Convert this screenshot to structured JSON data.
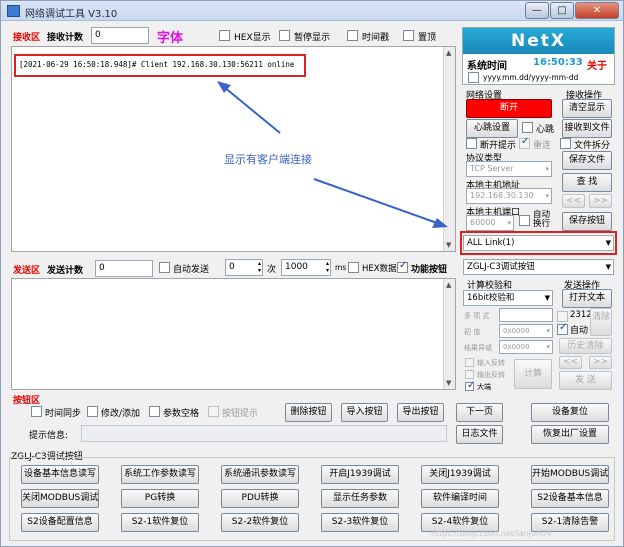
{
  "window": {
    "title": "网络调试工具  V3.10",
    "min": "—",
    "max": "□",
    "close": "✕"
  },
  "receive": {
    "area_label": "接收区",
    "count_label": "接收计数",
    "count_value": "0",
    "font_label": "字体",
    "hex_label": "HEX显示",
    "pause_label": "暂停显示",
    "timestamp_label": "时间戳",
    "top_label": "置顶",
    "log_line": "[2021-06-29 16:50:18.948]# Client 192.168.30.130:56211 online"
  },
  "annotation": {
    "text": "显示有客户端连接"
  },
  "netx": {
    "logo": "NetX",
    "time_label": "系统时间",
    "time_value": "16:50:33",
    "about_label": "关于",
    "date_format": "yyyy.mm.dd/yyyy-mm-dd"
  },
  "network": {
    "title": "网络设置",
    "disconnect": "断开",
    "heartbeat_settings": "心跳设置",
    "heartbeat": "心跳",
    "disconnect_prompt": "断开提示",
    "reconnect": "重连",
    "protocol_label": "协议类型",
    "protocol_value": "TCP Server",
    "host_label": "本地主机地址",
    "host_value": "192.168.30.130",
    "port_label": "本地主机端口",
    "port_value": "60000",
    "auto_wrap": "自动换行",
    "link_value": "ALL Link(1)"
  },
  "recv_ops": {
    "title": "接收操作",
    "clear": "清空显示",
    "to_file": "接收到文件",
    "split_file": "文件拆分",
    "save_file": "保存文件",
    "find": "查  找",
    "prev": "<<",
    "next": ">>",
    "save_buttons": "保存按钮"
  },
  "send": {
    "area_label": "发送区",
    "count_label": "发送计数",
    "count_value": "0",
    "auto_send": "自动发送",
    "times_value": "0",
    "times_unit": "次",
    "interval_value": "1000",
    "interval_unit": "ms",
    "hex_data": "HEX数据",
    "function_buttons": "功能按钮"
  },
  "calc": {
    "device_value": "ZGLJ-C3调试按钮",
    "checksum_title": "计算校验和",
    "checksum_value": "16bit校验和",
    "multi_item": "多 项 式",
    "init_value_label": "初   值",
    "init_value": "0x0000",
    "xor_label": "结果异或",
    "xor_value": "0x0000",
    "input_reverse": "输入反转",
    "output_reverse": "输出反转",
    "big_endian": "大端",
    "calc_button": "计算",
    "chk2312": "2312",
    "auto": "自动",
    "clear": "清除",
    "history_clear": "历史清除",
    "prev": "<<",
    "next": ">>",
    "send": "发  送"
  },
  "send_ops": {
    "title": "发送操作",
    "open_text": "打开文本"
  },
  "buttons_area": {
    "label": "按钮区",
    "time_sync": "时间同步",
    "modify_add": "修改/添加",
    "param_space": "参数空格",
    "button_tip": "按钮提示",
    "delete": "删除按钮",
    "import": "导入按钮",
    "export": "导出按钮",
    "next_page": "下一页",
    "device_reset": "设备复位",
    "tip_label": "提示信息:",
    "log_file": "日志文件",
    "factory_reset": "恢复出厂设置"
  },
  "panel": {
    "title": "ZGLJ-C3调试按钮",
    "buttons": [
      "设备基本信息读写",
      "系统工作参数读写",
      "系统通讯参数读写",
      "开启J1939调试",
      "关闭J1939调试",
      "开始MODBUS调试",
      "关闭MODBUS调试",
      "PG转换",
      "PDU转换",
      "显示任务参数",
      "软件编译时间",
      "S2设备基本信息",
      "S2设备配置信息",
      "S2-1软件复位",
      "S2-2软件复位",
      "S2-3软件复位",
      "S2-4软件复位",
      "S2-1清除告警"
    ]
  },
  "watermark": "https://blog.csdn.net/lanjun04",
  "colors": {
    "accent_red": "#e00000",
    "netx_blue": "#1e9bcc",
    "annotation_blue": "#3a63c8",
    "highlight_box": "#e02020"
  }
}
